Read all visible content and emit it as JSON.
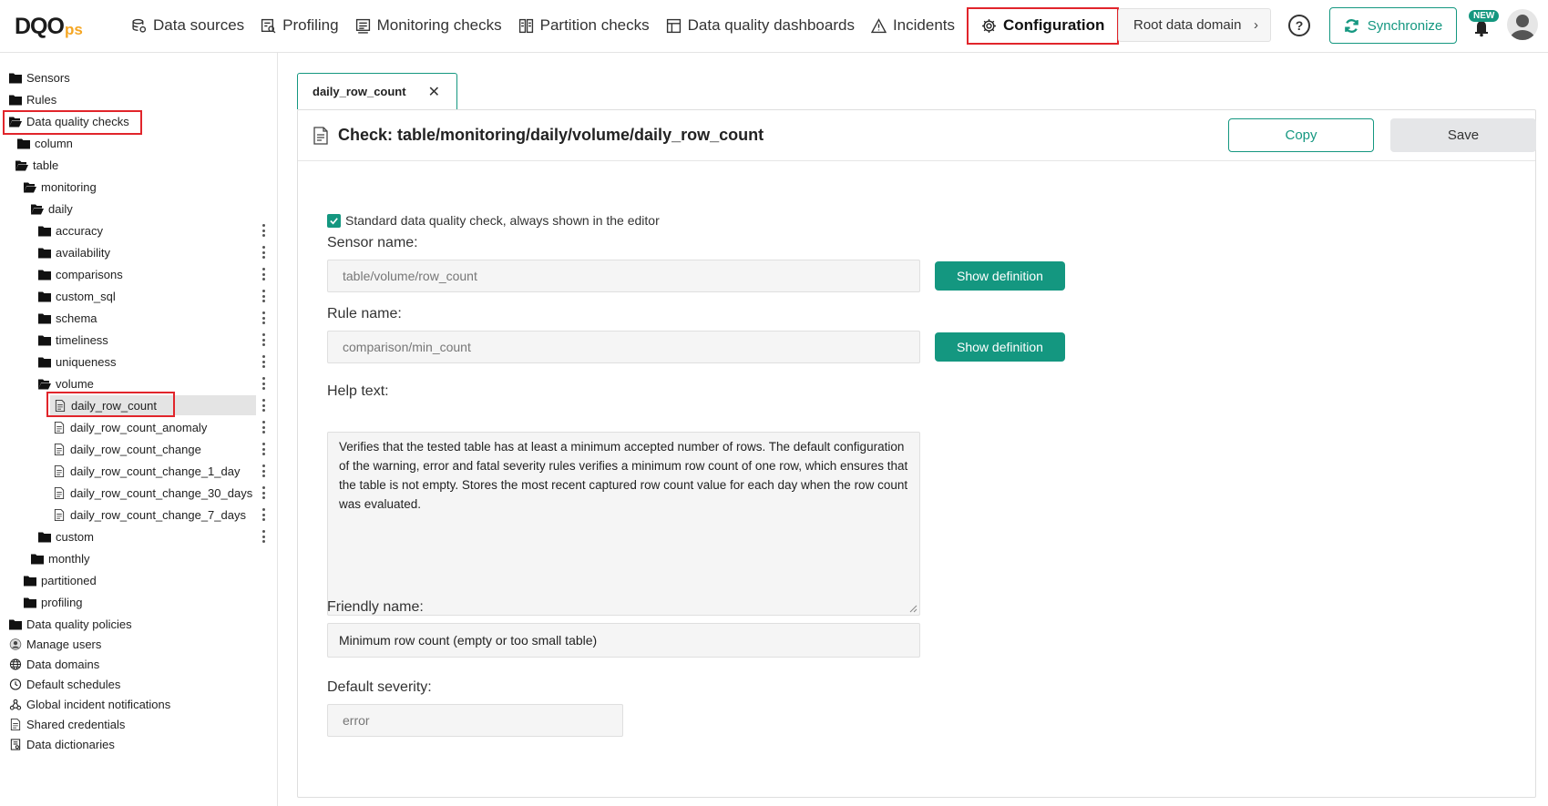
{
  "app": {
    "logo_main": "DQO",
    "logo_suffix": "ps"
  },
  "nav": {
    "items": [
      {
        "label": "Data sources",
        "icon": "database-icon"
      },
      {
        "label": "Profiling",
        "icon": "profiling-icon"
      },
      {
        "label": "Monitoring checks",
        "icon": "monitoring-icon"
      },
      {
        "label": "Partition checks",
        "icon": "partition-icon"
      },
      {
        "label": "Data quality dashboards",
        "icon": "dashboard-icon"
      },
      {
        "label": "Incidents",
        "icon": "warning-icon"
      },
      {
        "label": "Configuration",
        "icon": "gear-icon",
        "active": true
      }
    ],
    "domain_label": "Root data domain",
    "help_label": "?",
    "sync_label": "Synchronize",
    "new_badge": "NEW"
  },
  "tree": [
    {
      "label": "Sensors",
      "type": "folder",
      "open": false,
      "kebab": false
    },
    {
      "label": "Rules",
      "type": "folder",
      "open": false,
      "kebab": false
    },
    {
      "label": "Data quality checks",
      "type": "folder",
      "open": true,
      "kebab": false,
      "highlight": true
    },
    {
      "label": "column",
      "type": "folder",
      "open": false,
      "kebab": false
    },
    {
      "label": "table",
      "type": "folder",
      "open": true,
      "kebab": false
    },
    {
      "label": "monitoring",
      "type": "folder",
      "open": true,
      "kebab": false
    },
    {
      "label": "daily",
      "type": "folder",
      "open": true,
      "kebab": false
    },
    {
      "label": "accuracy",
      "type": "folder",
      "open": false,
      "kebab": true
    },
    {
      "label": "availability",
      "type": "folder",
      "open": false,
      "kebab": true
    },
    {
      "label": "comparisons",
      "type": "folder",
      "open": false,
      "kebab": true
    },
    {
      "label": "custom_sql",
      "type": "folder",
      "open": false,
      "kebab": true
    },
    {
      "label": "schema",
      "type": "folder",
      "open": false,
      "kebab": true
    },
    {
      "label": "timeliness",
      "type": "folder",
      "open": false,
      "kebab": true
    },
    {
      "label": "uniqueness",
      "type": "folder",
      "open": false,
      "kebab": true
    },
    {
      "label": "volume",
      "type": "folder",
      "open": true,
      "kebab": true
    },
    {
      "label": "daily_row_count",
      "type": "file",
      "kebab": true,
      "selected": true,
      "highlight": true
    },
    {
      "label": "daily_row_count_anomaly",
      "type": "file",
      "kebab": true
    },
    {
      "label": "daily_row_count_change",
      "type": "file",
      "kebab": true
    },
    {
      "label": "daily_row_count_change_1_day",
      "type": "file",
      "kebab": true
    },
    {
      "label": "daily_row_count_change_30_days",
      "type": "file",
      "kebab": true
    },
    {
      "label": "daily_row_count_change_7_days",
      "type": "file",
      "kebab": true
    },
    {
      "label": "custom",
      "type": "folder",
      "open": false,
      "kebab": true
    },
    {
      "label": "monthly",
      "type": "folder",
      "open": false,
      "kebab": false
    },
    {
      "label": "partitioned",
      "type": "folder",
      "open": false,
      "kebab": false
    },
    {
      "label": "profiling",
      "type": "folder",
      "open": false,
      "kebab": false
    },
    {
      "label": "Data quality policies",
      "type": "folder",
      "open": false,
      "kebab": false
    },
    {
      "label": "Manage users",
      "type": "user",
      "kebab": false
    },
    {
      "label": "Data domains",
      "type": "globe",
      "kebab": false
    },
    {
      "label": "Default schedules",
      "type": "clock",
      "kebab": false
    },
    {
      "label": "Global incident notifications",
      "type": "webhook",
      "kebab": false
    },
    {
      "label": "Shared credentials",
      "type": "file",
      "kebab": false
    },
    {
      "label": "Data dictionaries",
      "type": "book",
      "kebab": false
    }
  ],
  "editor": {
    "tab_label": "daily_row_count",
    "title": "Check: table/monitoring/daily/volume/daily_row_count",
    "copy_label": "Copy",
    "save_label": "Save",
    "standard_check_label": "Standard data quality check, always shown in the editor",
    "standard_check_checked": true,
    "sensor_label": "Sensor name:",
    "sensor_value": "table/volume/row_count",
    "rule_label": "Rule name:",
    "rule_value": "comparison/min_count",
    "show_definition_label": "Show definition",
    "help_label": "Help text:",
    "help_text": "Verifies that the tested table has at least a minimum accepted number of rows. The default configuration of the warning, error and fatal severity rules verifies a minimum row count of one row, which ensures that the table is not empty. Stores the most recent captured row count value for each day when the row count was evaluated.",
    "friendly_label": "Friendly name:",
    "friendly_value": "Minimum row count (empty or too small table)",
    "severity_label": "Default severity:",
    "severity_value": "error"
  },
  "colors": {
    "accent": "#149780",
    "highlight_border": "#e1252b",
    "logo_suffix": "#f5a623"
  }
}
